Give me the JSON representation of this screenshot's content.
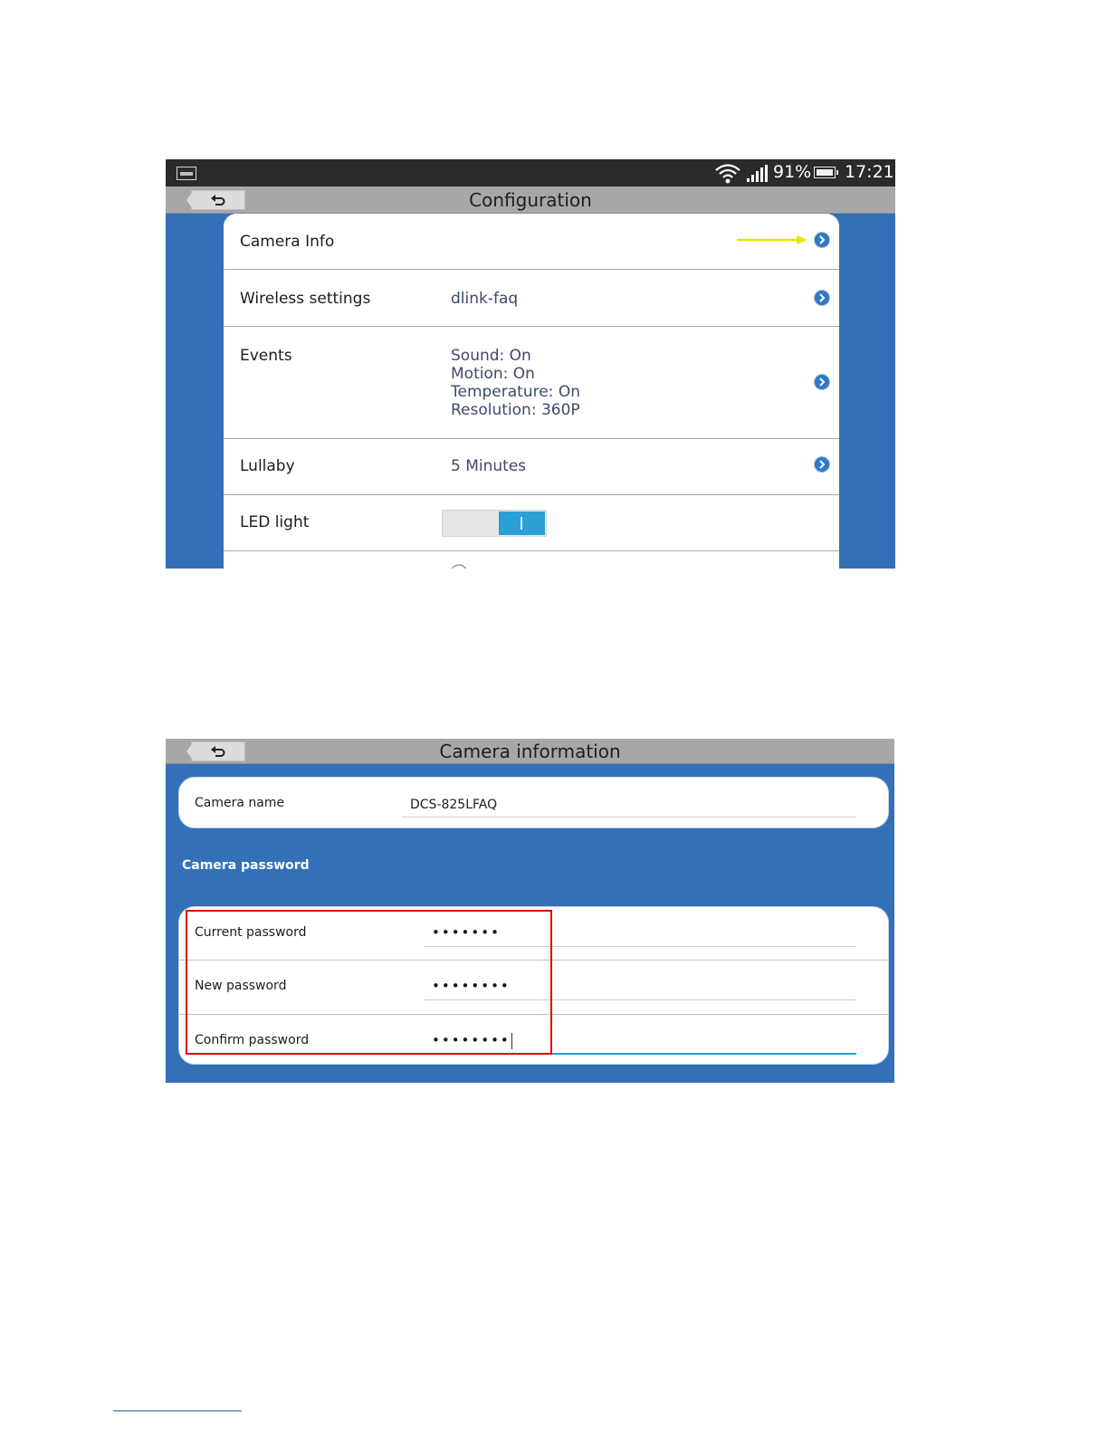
{
  "config_screen": {
    "status_bar": {
      "battery_percent": "91%",
      "time": "17:21"
    },
    "title": "Configuration",
    "rows": [
      {
        "label": "Camera Info",
        "value": ""
      },
      {
        "label": "Wireless settings",
        "value": "dlink-faq"
      },
      {
        "label": "Events",
        "values": [
          "Sound: On",
          "Motion: On",
          "Temperature: On",
          "Resolution: 360P"
        ]
      },
      {
        "label": "Lullaby",
        "value": "5 Minutes"
      },
      {
        "label": "LED light",
        "toggle_state": "on"
      }
    ],
    "annotation_arrow_color": "#e8e600"
  },
  "camera_info_screen": {
    "title": "Camera information",
    "camera_name_label": "Camera name",
    "camera_name_value": "DCS-825LFAQ",
    "password_section_label": "Camera password",
    "password_fields": [
      {
        "label": "Current password",
        "masked_value": "•••••••"
      },
      {
        "label": "New password",
        "masked_value": "••••••••"
      },
      {
        "label": "Confirm password",
        "masked_value": "••••••••"
      }
    ],
    "highlight_color": "#e00000"
  },
  "colors": {
    "background_blue": "#3370b8",
    "title_bar_gray": "#a7a7a7",
    "toggle_on": "#2aa0d4",
    "chevron_blue": "#2f78c8"
  }
}
